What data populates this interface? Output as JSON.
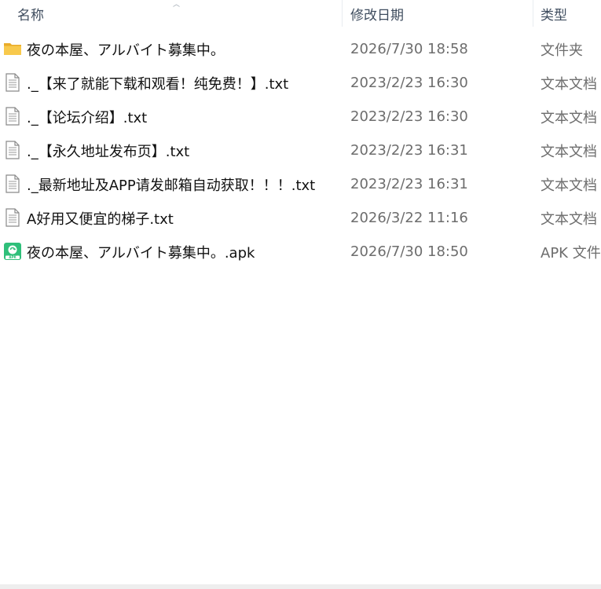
{
  "columns": {
    "name": "名称",
    "modified": "修改日期",
    "type": "类型"
  },
  "files": [
    {
      "name": "夜の本屋、アルバイト募集中。",
      "modified": "2026/7/30 18:58",
      "type": "文件夹",
      "icon": "folder-icon"
    },
    {
      "name": "._【来了就能下载和观看！纯免费！】.txt",
      "modified": "2023/2/23 16:30",
      "type": "文本文档",
      "icon": "text-file-icon"
    },
    {
      "name": "._【论坛介绍】.txt",
      "modified": "2023/2/23 16:30",
      "type": "文本文档",
      "icon": "text-file-icon"
    },
    {
      "name": "._【永久地址发布页】.txt",
      "modified": "2023/2/23 16:31",
      "type": "文本文档",
      "icon": "text-file-icon"
    },
    {
      "name": "._最新地址及APP请发邮箱自动获取！！！.txt",
      "modified": "2023/2/23 16:31",
      "type": "文本文档",
      "icon": "text-file-icon"
    },
    {
      "name": "A好用又便宜的梯子.txt",
      "modified": "2026/3/22 11:16",
      "type": "文本文档",
      "icon": "text-file-icon"
    },
    {
      "name": "夜の本屋、アルバイト募集中。.apk",
      "modified": "2026/7/30 18:50",
      "type": "APK 文件",
      "icon": "apk-file-icon"
    }
  ],
  "colors": {
    "header_text": "#3e4c5e",
    "name_text": "#111111",
    "meta_text": "#6d6d6d",
    "folder": "#f5c242",
    "apk": "#2fbf7a"
  }
}
